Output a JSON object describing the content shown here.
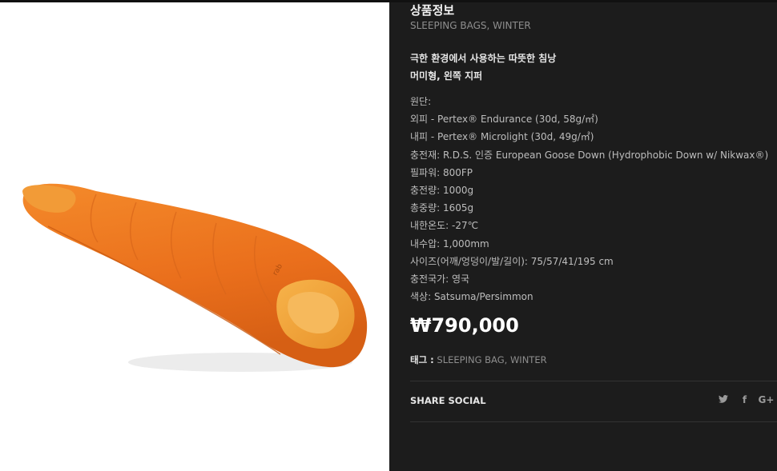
{
  "product": {
    "title": "상품정보",
    "categories": [
      "SLEEPING BAGS",
      "WINTER"
    ],
    "summary_lines": [
      "극한 환경에서 사용하는 따뜻한 침낭",
      "머미형, 왼쪽 지퍼"
    ],
    "specs": [
      "원단:",
      "외피 - Pertex® Endurance (30d, 58g/㎡)",
      "내피 - Pertex® Microlight (30d, 49g/㎡)",
      "충전재: R.D.S. 인증 European Goose Down (Hydrophobic Down w/ Nikwax®)",
      "필파워: 800FP",
      "충전량: 1000g",
      "총중량: 1605g",
      "내한온도: -27℃",
      "내수압: 1,000mm",
      "사이즈(어깨/엉덩이/발/길이): 75/57/41/195 cm",
      "충전국가: 영국",
      "색상: Satsuma/Persimmon"
    ],
    "price": "₩790,000",
    "tags_label": "태그 :",
    "tags": [
      "SLEEPING BAG",
      "WINTER"
    ]
  },
  "share": {
    "label": "SHARE SOCIAL",
    "twitter_glyph": "🐦",
    "facebook_glyph": "f",
    "googleplus_glyph": "G+"
  },
  "image": {
    "brand_print": "rab",
    "colors": {
      "outer": "#ef7a1f",
      "inner": "#f4a63a",
      "shadow": "#c85a12"
    }
  },
  "colors": {
    "panel_bg": "#1c1c1c",
    "price": "#ffffff",
    "muted": "#8e8e8e"
  }
}
